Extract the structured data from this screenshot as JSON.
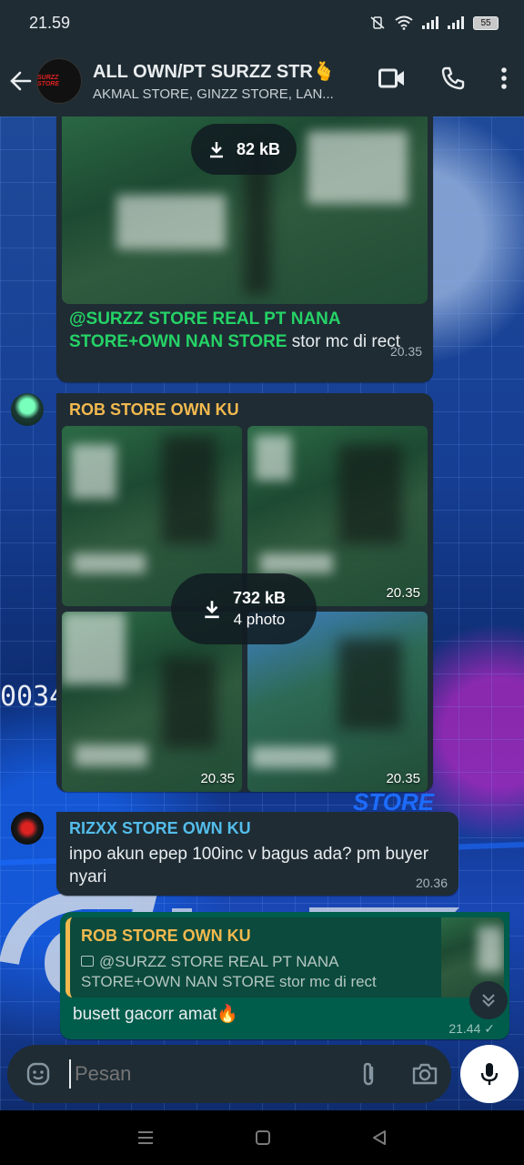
{
  "status_bar": {
    "time": "21.59",
    "battery": "55"
  },
  "header": {
    "title": "ALL OWN/PT SURZZ STR🫰",
    "subtitle": "AKMAL STORE, GINZZ STORE, LAN...",
    "avatar_text": "SURZZ STORE"
  },
  "background": {
    "number": "0034"
  },
  "messages": {
    "m1": {
      "download_size": "82 kB",
      "mention": "@SURZZ STORE REAL PT NANA STORE+OWN NAN STORE",
      "text": " stor mc di rect",
      "time": "20.35"
    },
    "m2": {
      "sender": "ROB STORE OWN KU",
      "sender_color": "#f2b94e",
      "download_size": "732 kB",
      "download_count": "4 photo",
      "time_tr": "20.35",
      "time_bl": "20.35",
      "time_br": "20.35"
    },
    "m3": {
      "sender": "RIZXX STORE OWN KU",
      "sender_color": "#53bdeb",
      "text": "inpo akun epep 100inc v bagus ada? pm buyer nyari",
      "time": "20.36"
    },
    "m4": {
      "quote_sender": "ROB STORE OWN KU",
      "quote_text": "@SURZZ STORE REAL PT NANA STORE+OWN NAN STORE stor mc di rect",
      "text": "busett gacorr amat🔥",
      "time": "21.44 ✓"
    }
  },
  "input": {
    "placeholder": "Pesan"
  },
  "colors": {
    "accent_green": "#25d366",
    "mention_green": "#25d366",
    "out_bubble": "#005c4b",
    "in_bubble": "#1f2c34"
  }
}
